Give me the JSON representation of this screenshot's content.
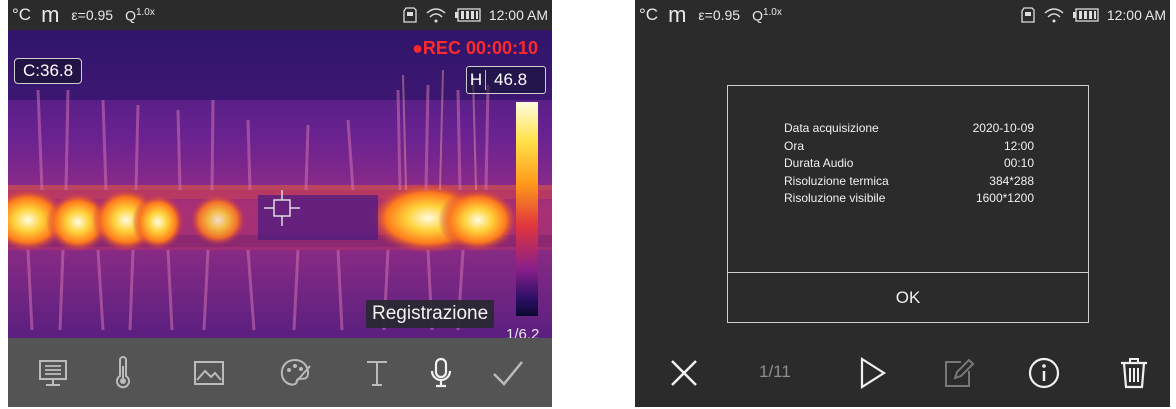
{
  "left": {
    "status": {
      "unit": "°C",
      "mode": "m",
      "emissivity": "ε=0.95",
      "zoom_icon": "magnifier-icon",
      "zoom": "1.0x",
      "time": "12:00 AM"
    },
    "cursor_value": "C:36.8",
    "rec": "●REC 00:00:10",
    "high_label": "H",
    "high_value": "46.8",
    "tooltip": "Registrazione",
    "partial_text": "1/6.2",
    "toolbar": [
      "display-icon",
      "thermometer-icon",
      "image-icon",
      "palette-icon",
      "text-icon",
      "microphone-icon",
      "checkmark-icon"
    ]
  },
  "right": {
    "status": {
      "unit": "°C",
      "mode": "m",
      "emissivity": "ε=0.95",
      "zoom": "1.0x",
      "time": "12:00 AM"
    },
    "info": [
      {
        "label": "Data acquisizione",
        "value": "2020-10-09"
      },
      {
        "label": "Ora",
        "value": "12:00"
      },
      {
        "label": "Durata Audio",
        "value": "00:10"
      },
      {
        "label": "Risoluzione termica",
        "value": "384*288"
      },
      {
        "label": "Risoluzione visibile",
        "value": "1600*1200"
      }
    ],
    "ok": "OK",
    "page": "1/11",
    "toolbar": [
      "close-icon",
      "play-icon",
      "edit-icon",
      "info-icon",
      "trash-icon"
    ]
  },
  "colors": {
    "background": "#2b2b2b",
    "toolbar": "#545454",
    "rec": "#ff2a2a",
    "scale_top": "#fffbe0",
    "scale_bottom": "#0c0830"
  }
}
